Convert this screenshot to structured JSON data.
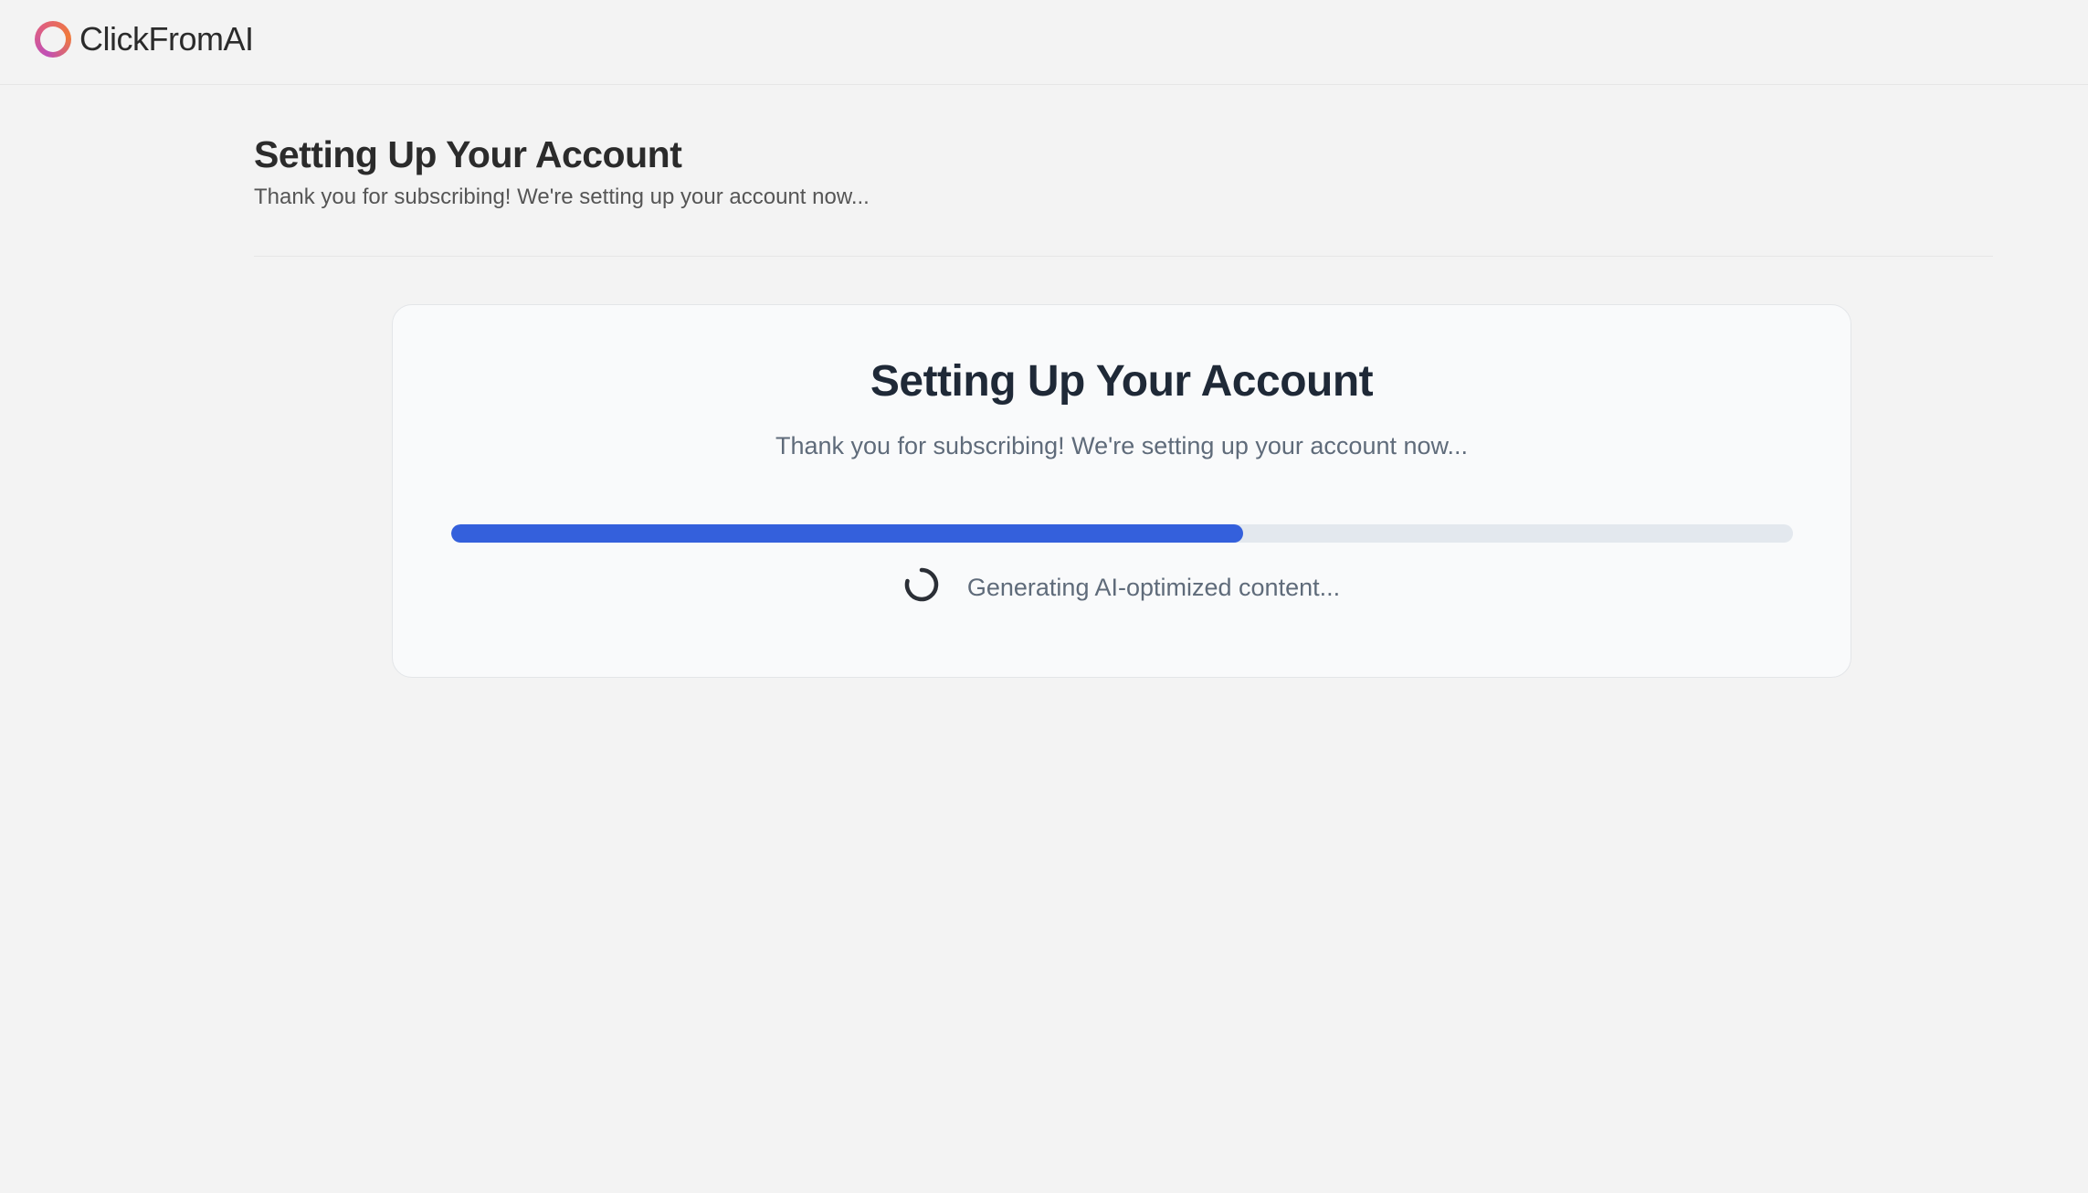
{
  "header": {
    "brand": "ClickFromAI",
    "logo_icon": "ring-logo-icon",
    "logo_colors": [
      "#c04fb6",
      "#e0607e",
      "#f07a3a"
    ]
  },
  "page": {
    "title": "Setting Up Your Account",
    "subtitle": "Thank you for subscribing! We're setting up your account now..."
  },
  "card": {
    "title": "Setting Up Your Account",
    "subtitle": "Thank you for subscribing! We're setting up your account now...",
    "progress_percent": 59,
    "progress_color": "#3460dc",
    "status_icon": "spinner-icon",
    "status_text": "Generating AI-optimized content..."
  }
}
